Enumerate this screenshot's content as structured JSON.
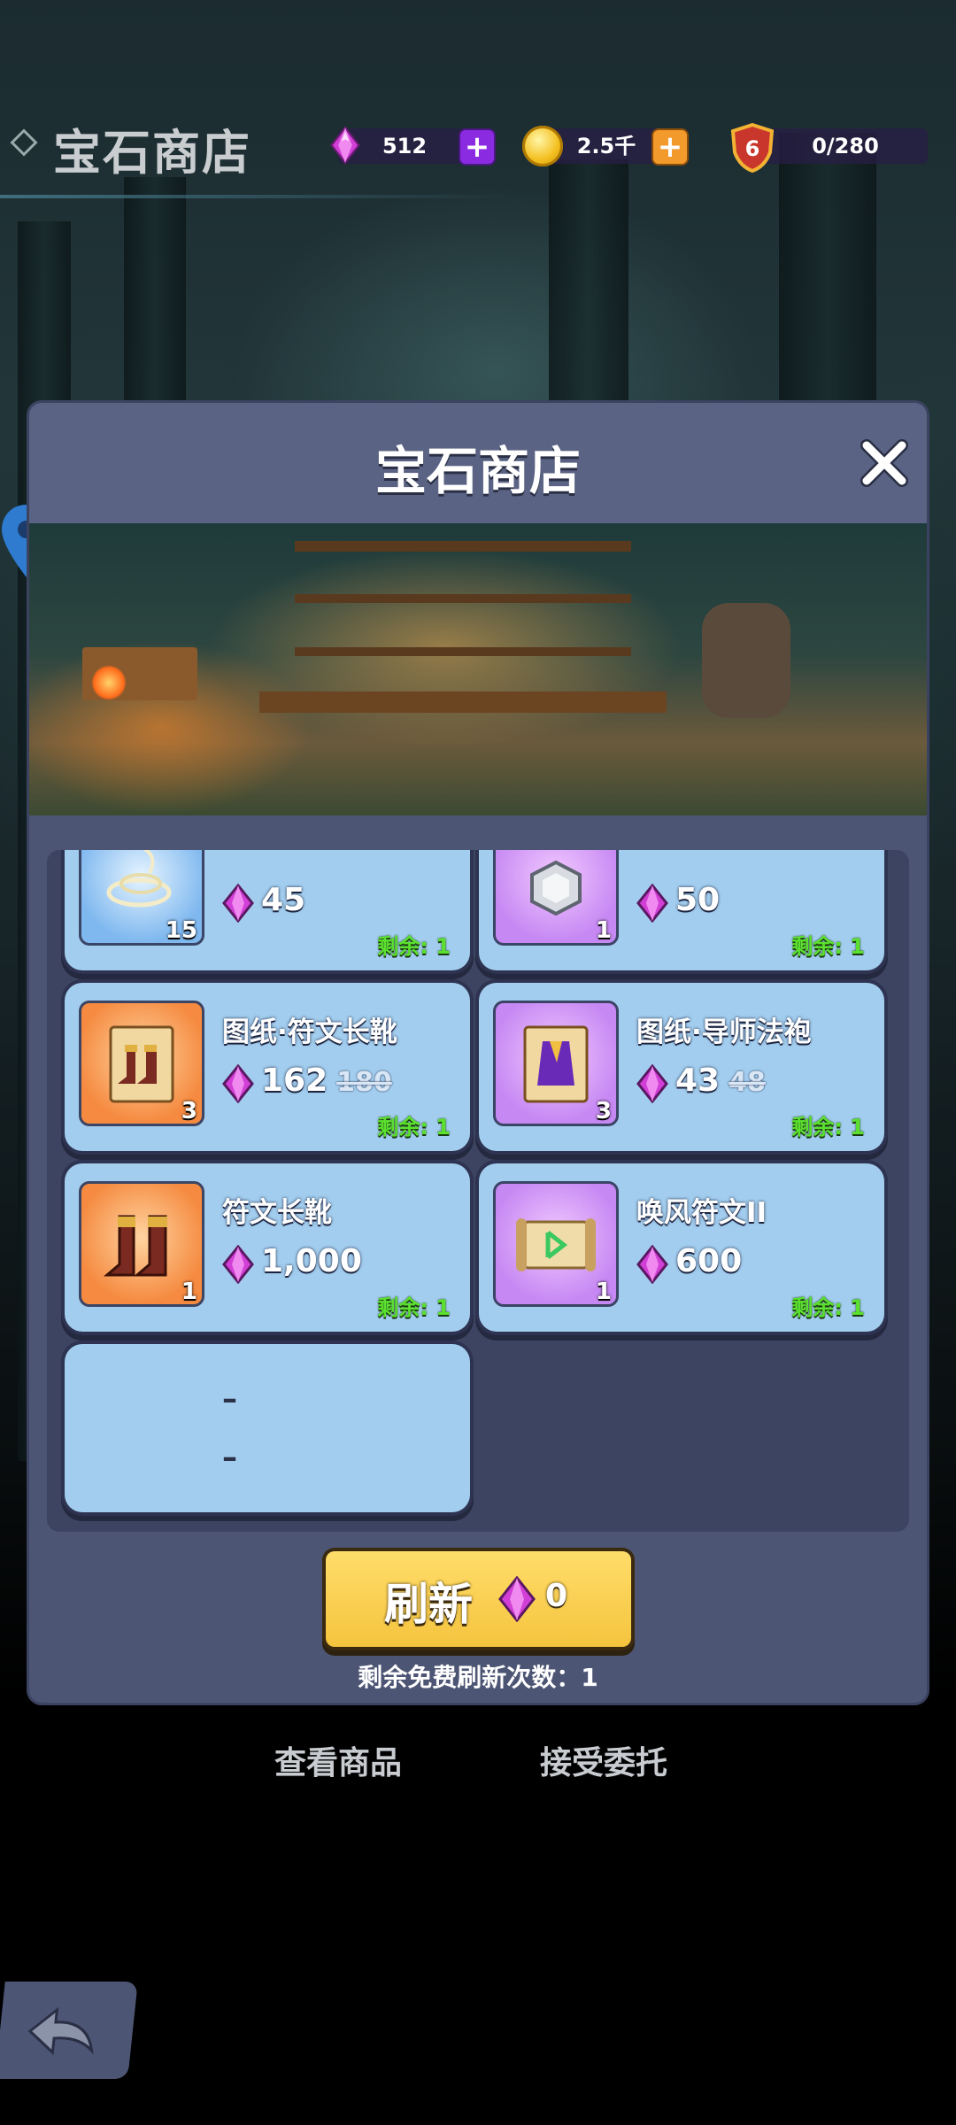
{
  "header": {
    "title": "宝石商店",
    "gems": "512",
    "coins": "2.5千",
    "level": "6",
    "capacity": "0/280"
  },
  "modal": {
    "title": "宝石商店",
    "items": [
      {
        "name": "",
        "qty": "15",
        "price": "45",
        "old_price": "",
        "remain": "剩余: 1",
        "icon": "rope-icon",
        "rarity": "blue"
      },
      {
        "name": "",
        "qty": "1",
        "price": "50",
        "old_price": "",
        "remain": "剩余: 1",
        "icon": "silver-ore-icon",
        "rarity": "purple"
      },
      {
        "name": "图纸·符文长靴",
        "qty": "3",
        "price": "162",
        "old_price": "180",
        "remain": "剩余: 1",
        "icon": "boots-blueprint-icon",
        "rarity": "orange"
      },
      {
        "name": "图纸·导师法袍",
        "qty": "3",
        "price": "43",
        "old_price": "48",
        "remain": "剩余: 1",
        "icon": "robe-blueprint-icon",
        "rarity": "purple"
      },
      {
        "name": "符文长靴",
        "qty": "1",
        "price": "1,000",
        "old_price": "",
        "remain": "剩余: 1",
        "icon": "boots-icon",
        "rarity": "orange"
      },
      {
        "name": "唤风符文II",
        "qty": "1",
        "price": "600",
        "old_price": "",
        "remain": "剩余: 1",
        "icon": "rune-scroll-icon",
        "rarity": "purple"
      }
    ],
    "empty_slot": {
      "line1": "–",
      "line2": "–"
    },
    "refresh": {
      "label": "刷新",
      "cost": "0"
    },
    "free_refresh_text": "剩余免费刷新次数：1"
  },
  "behind": {
    "view_goods": "查看商品",
    "accept_commission": "接受委托"
  },
  "colors": {
    "card_bg": "#a2cdee",
    "remain_green": "#5be02f",
    "refresh_yellow": "#f5c43e",
    "modal_bg": "#4d5574"
  }
}
